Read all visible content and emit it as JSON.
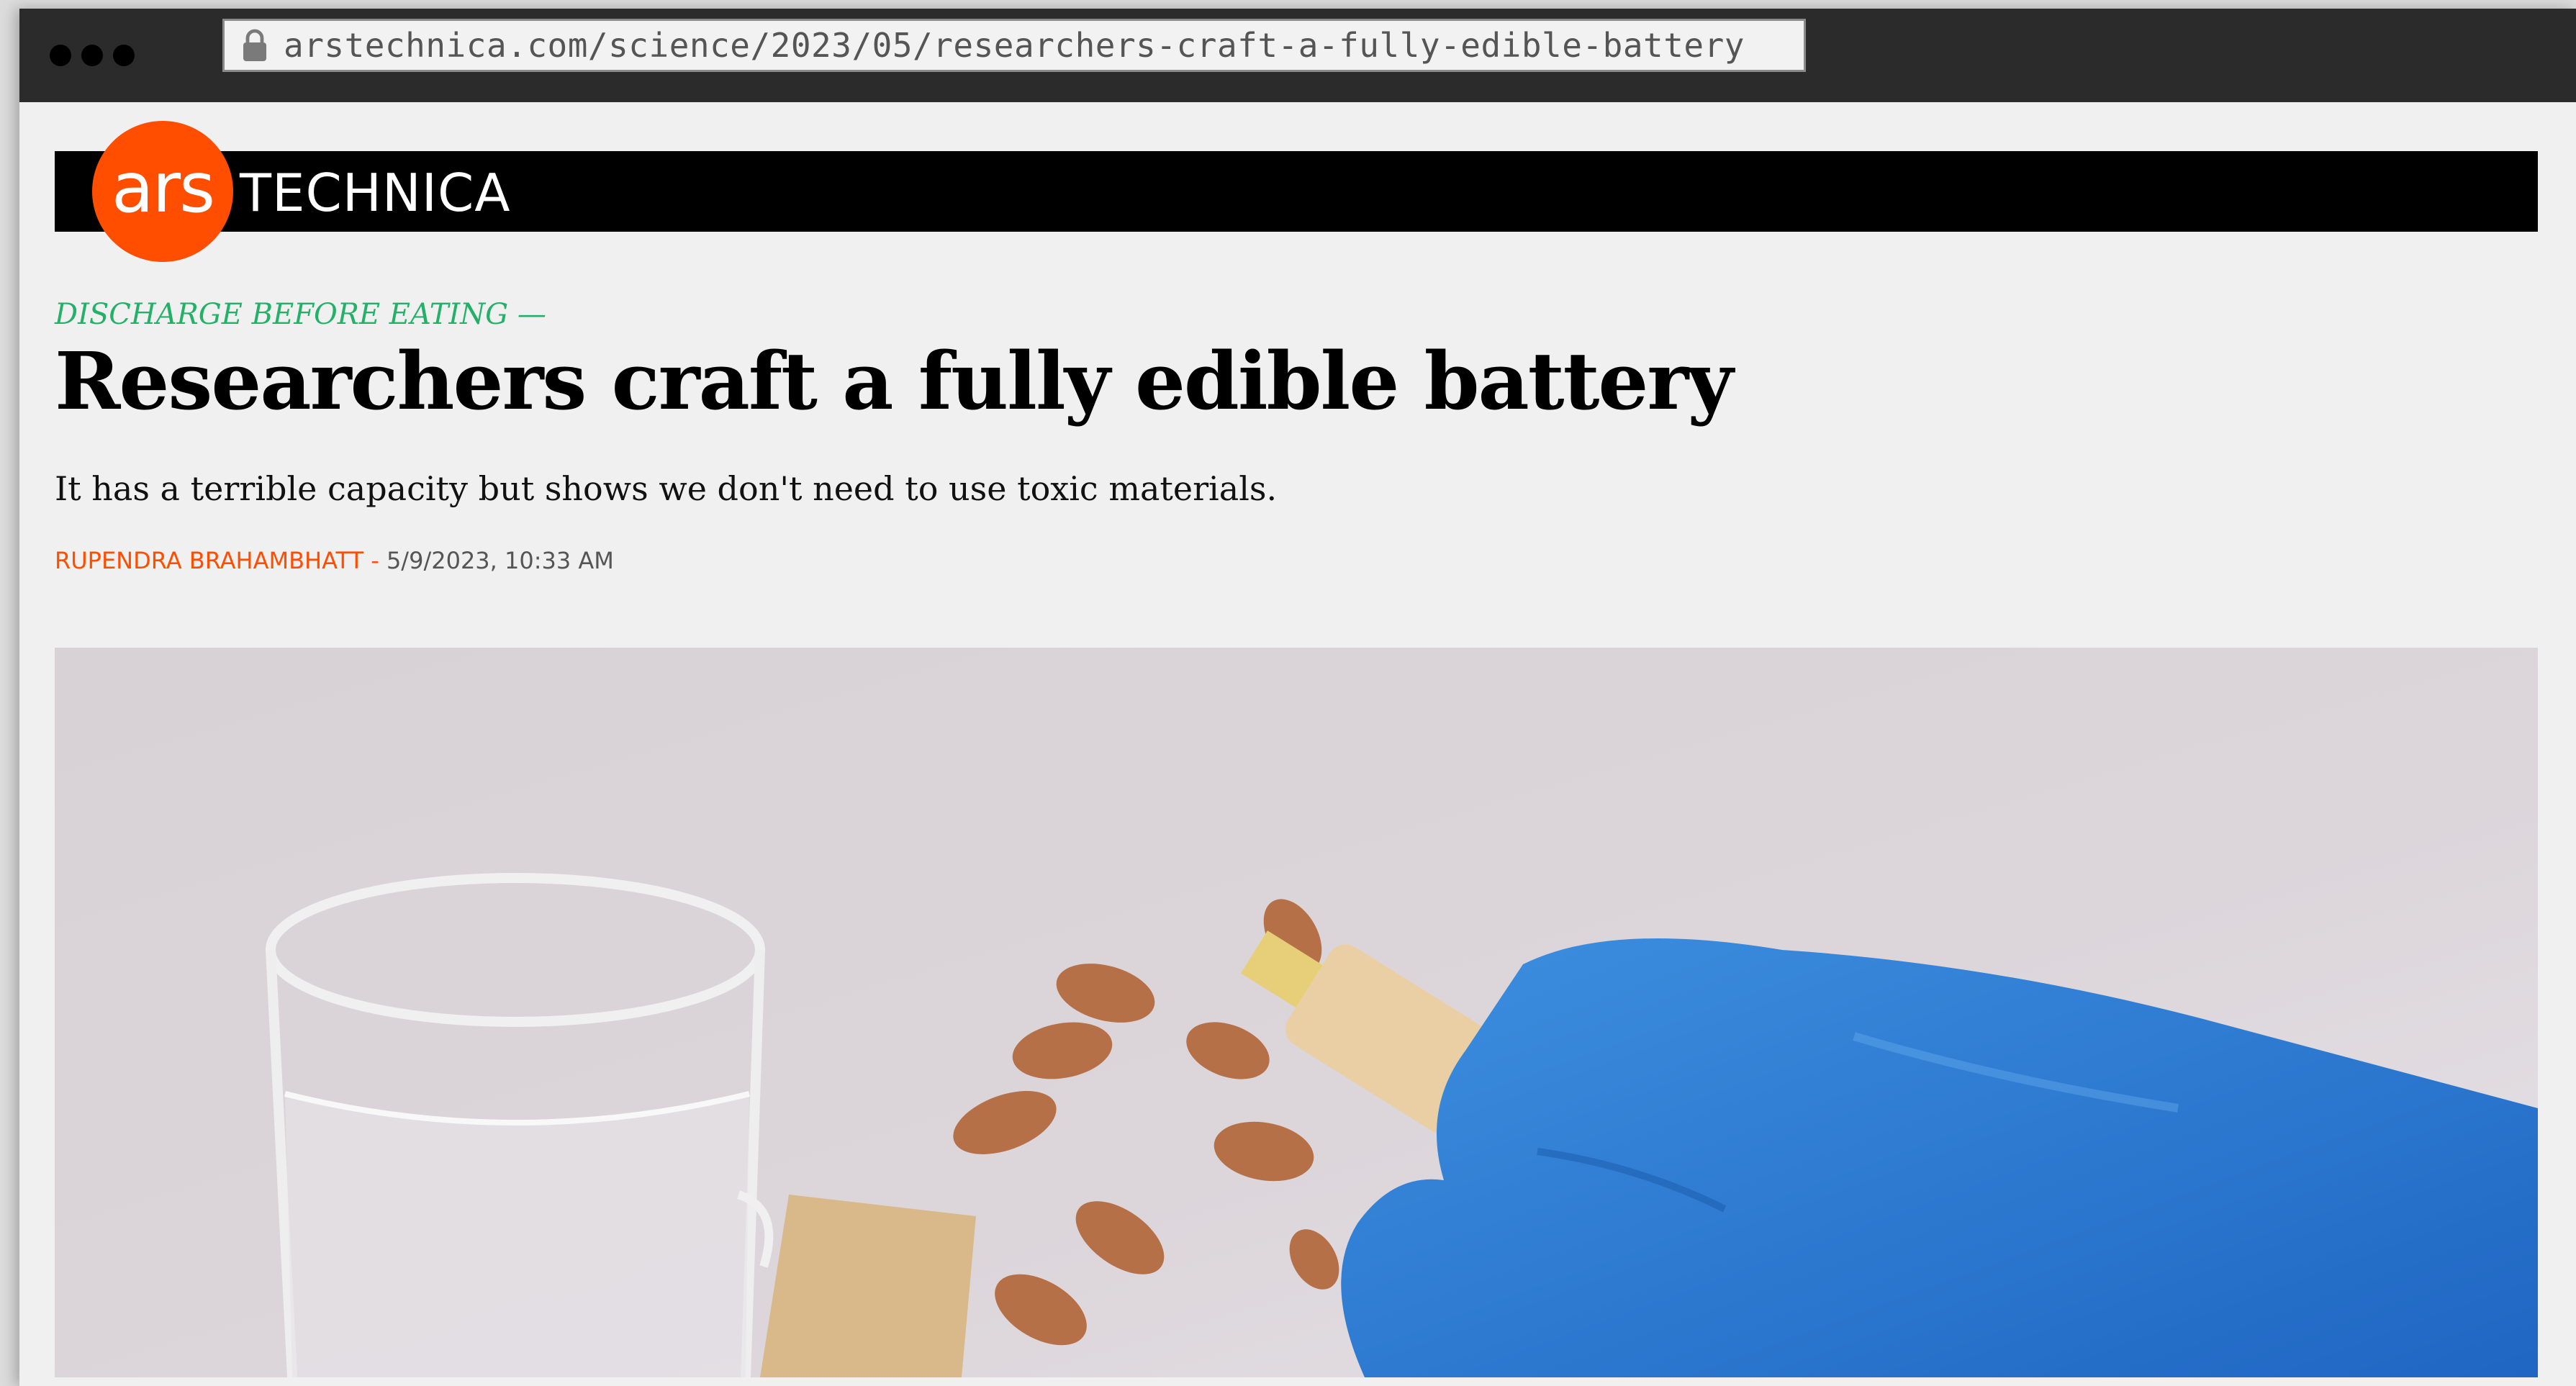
{
  "browser": {
    "url": "arstechnica.com/science/2023/05/researchers-craft-a-fully-edible-battery",
    "icons": {
      "lock": "lock-icon"
    }
  },
  "site": {
    "logo_ars": "ars",
    "logo_technica": "TECHNICA",
    "accent_color": "#ff4e00",
    "kicker_color": "#25b06a"
  },
  "article": {
    "kicker": "DISCHARGE BEFORE EATING —",
    "title": "Researchers craft a fully edible battery",
    "dek": "It has a terrible capacity but shows we don't need to use toxic materials.",
    "author": "RUPENDRA BRAHAMBHATT",
    "separator": " - ",
    "date": "5/9/2023, 10:33 AM"
  }
}
